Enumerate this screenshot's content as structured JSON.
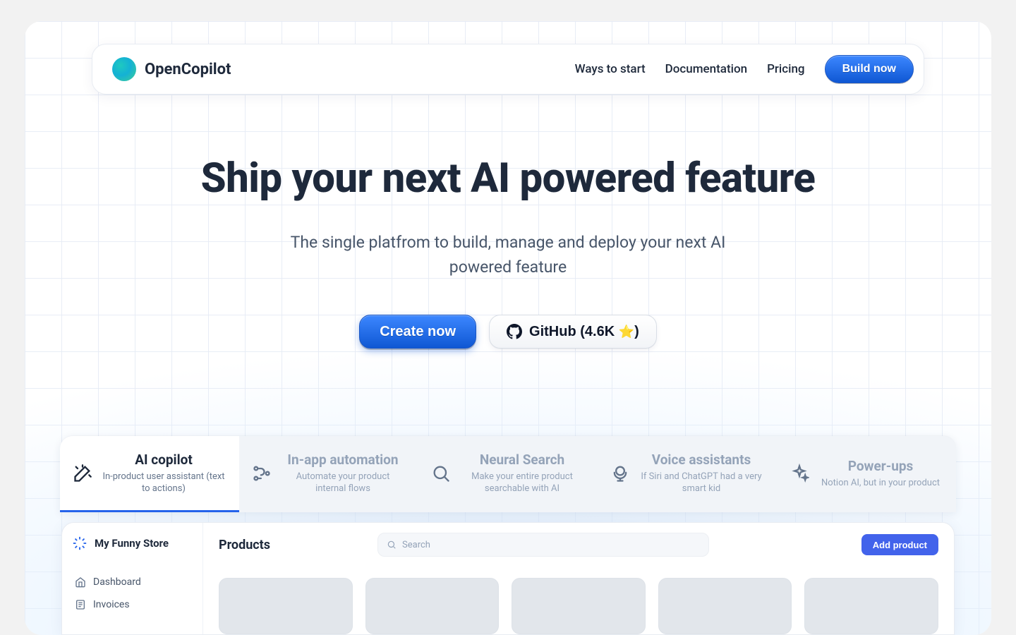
{
  "header": {
    "brand": "OpenCopilot",
    "nav": {
      "ways": "Ways to start",
      "docs": "Documentation",
      "pricing": "Pricing"
    },
    "build_button": "Build now"
  },
  "hero": {
    "headline": "Ship your next AI powered feature",
    "subline_1": "The single platfrom to build, manage and deploy your next AI",
    "subline_2": "powered feature",
    "create_button": "Create now",
    "github_prefix": "GitHub (",
    "github_stars": "4.6K",
    "github_suffix": ")"
  },
  "features": [
    {
      "title": "AI copilot",
      "sub": "In-product user assistant (text to actions)"
    },
    {
      "title": "In-app automation",
      "sub": "Automate your product internal flows"
    },
    {
      "title": "Neural Search",
      "sub": "Make your entire product searchable with AI"
    },
    {
      "title": "Voice assistants",
      "sub": "If Siri and ChatGPT had a very smart kid"
    },
    {
      "title": "Power-ups",
      "sub": "Notion AI, but in your product"
    }
  ],
  "preview": {
    "store_name": "My Funny Store",
    "sidebar": {
      "dashboard": "Dashboard",
      "invoices": "Invoices"
    },
    "main": {
      "title": "Products",
      "search_placeholder": "Search",
      "add_button": "Add product"
    }
  }
}
